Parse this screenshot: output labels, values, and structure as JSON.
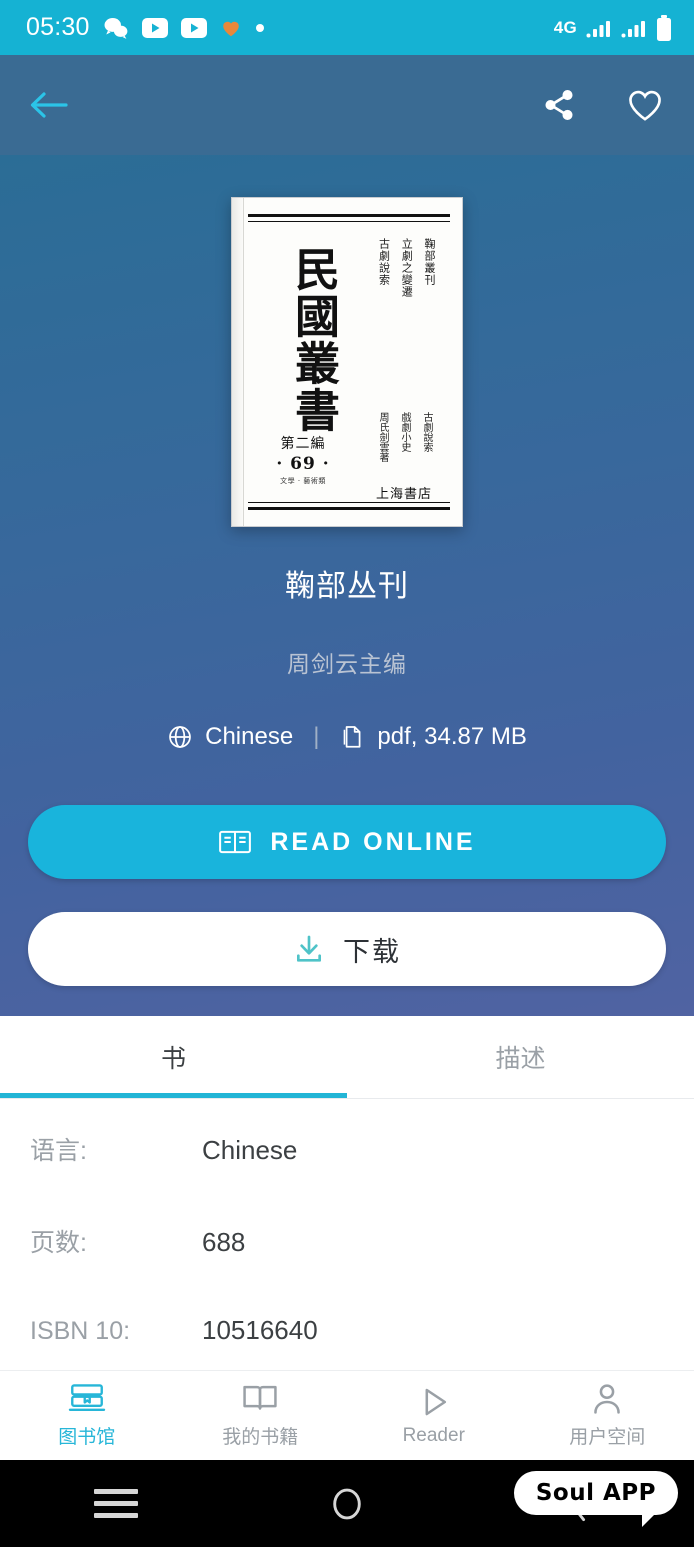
{
  "status_bar": {
    "time": "05:30",
    "network": "4G",
    "icons": [
      "wechat-icon",
      "video-icon",
      "video-icon",
      "heart-icon",
      "dot-icon"
    ],
    "right_icons": [
      "signal-icon",
      "signal-icon",
      "battery-icon"
    ],
    "bg_color": "#15B2D3"
  },
  "app_bar": {
    "back_label": "返回",
    "share_label": "分享",
    "favorite_label": "收藏",
    "bg_color": "#3A6B93"
  },
  "hero": {
    "gradient_top": "#2B6D96",
    "gradient_bottom": "#5063A2",
    "cover": {
      "main_title": "民國叢書",
      "side_lines": [
        "鞠部叢刊",
        "立劇之變遷",
        "古劇說索"
      ],
      "author_lines": [
        "古劇說索",
        "戲劇小史",
        "周氏劍雲著"
      ],
      "publisher": "上海書店",
      "volume_line1": "第二編",
      "volume_line2": "· 69 ·",
      "volume_line3": "文學 · 藝術類"
    },
    "title": "鞠部丛刊",
    "author": "周剑云主编",
    "language": "Chinese",
    "separator": "|",
    "format": "pdf, 34.87 MB",
    "read_button": "READ ONLINE",
    "download_button": "下载",
    "read_button_color": "#19B4DC"
  },
  "tabs": [
    {
      "label": "书",
      "active": true
    },
    {
      "label": "描述",
      "active": false
    }
  ],
  "details": [
    {
      "key": "语言:",
      "value": "Chinese"
    },
    {
      "key": "页数:",
      "value": "688"
    },
    {
      "key": "ISBN 10:",
      "value": "10516640"
    }
  ],
  "bottom_nav": [
    {
      "label": "图书馆",
      "icon": "library-books-icon",
      "active": true
    },
    {
      "label": "我的书籍",
      "icon": "open-book-icon",
      "active": false
    },
    {
      "label": "Reader",
      "icon": "play-triangle-icon",
      "active": false
    },
    {
      "label": "用户空间",
      "icon": "person-icon",
      "active": false
    }
  ],
  "android_nav": {
    "recents_label": "最近任务",
    "home_label": "主页",
    "back_label": "返回"
  },
  "overlay": {
    "soul_bubble": "Soul APP"
  },
  "accent_color": "#22B5D6"
}
